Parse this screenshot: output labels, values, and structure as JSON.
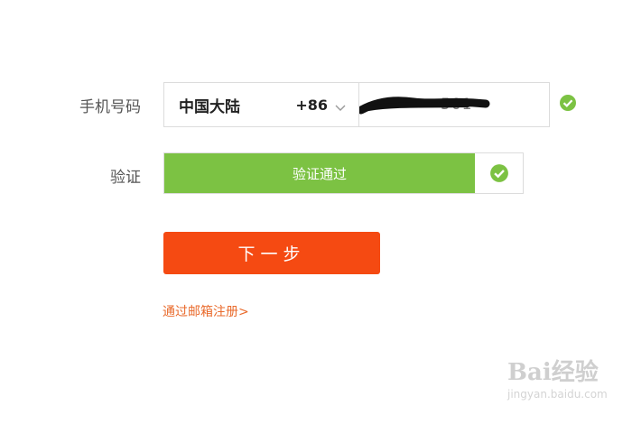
{
  "form": {
    "phone_label": "手机号码",
    "region_name": "中国大陆",
    "region_code": "+86",
    "phone_value": "501",
    "verify_label": "验证",
    "verify_status": "验证通过",
    "next_button": "下一步",
    "email_link": "通过邮箱注册>"
  },
  "watermark": {
    "text": "Bai经验",
    "sub": "jingyan.baidu.com"
  },
  "colors": {
    "success_green": "#7cc243",
    "primary_orange": "#f54a12",
    "link_orange": "#e96a2b"
  },
  "icons": {
    "phone_valid": "check-circle-icon",
    "verify_ok": "check-circle-icon",
    "region_dropdown": "chevron-down-icon"
  }
}
